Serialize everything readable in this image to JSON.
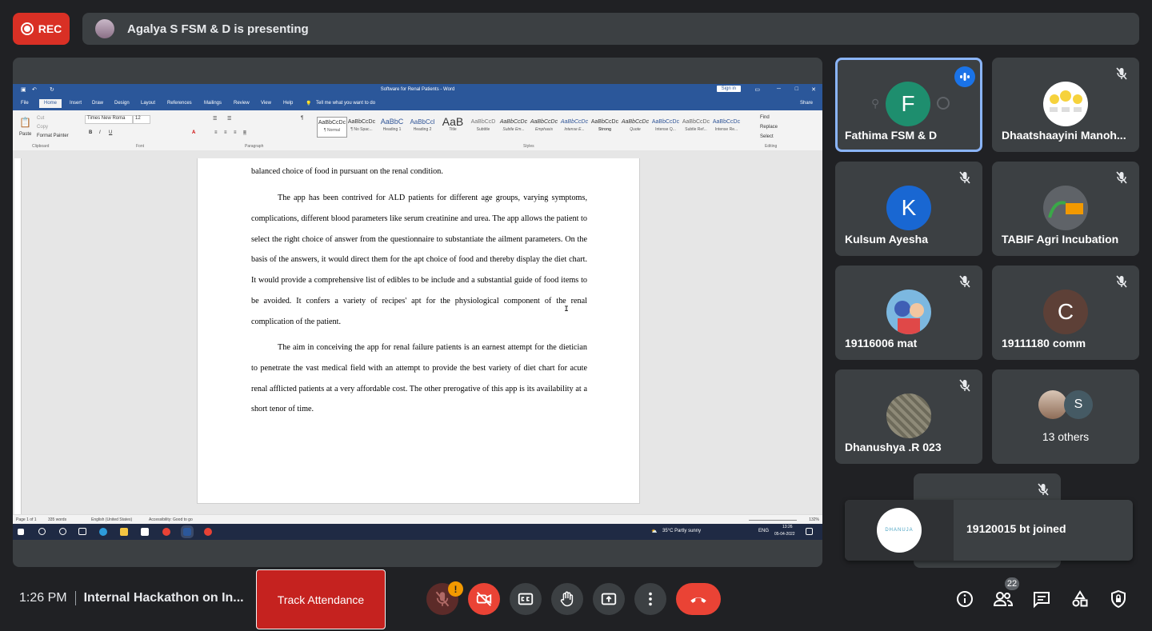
{
  "recording": {
    "label": "REC"
  },
  "presenting": {
    "text": "Agalya S FSM & D is presenting"
  },
  "word": {
    "title": "Software for Renal Patients - Word",
    "sign_in": "Sign in",
    "tabs": [
      "File",
      "Home",
      "Insert",
      "Draw",
      "Design",
      "Layout",
      "References",
      "Mailings",
      "Review",
      "View",
      "Help"
    ],
    "tell_me": "Tell me what you want to do",
    "share": "Share",
    "font_name": "Times New Roma",
    "font_size": "12",
    "clipboard": {
      "cut": "Cut",
      "copy": "Copy",
      "format_painter": "Format Painter",
      "paste": "Paste"
    },
    "groups": {
      "clipboard": "Clipboard",
      "font": "Font",
      "paragraph": "Paragraph",
      "styles": "Styles",
      "editing": "Editing"
    },
    "styles": [
      {
        "sample": "AaBbCcDc",
        "name": "¶ Normal"
      },
      {
        "sample": "AaBbCcDc",
        "name": "¶ No Spac..."
      },
      {
        "sample": "AaBbC",
        "name": "Heading 1"
      },
      {
        "sample": "AaBbCcl",
        "name": "Heading 2"
      },
      {
        "sample": "AaB",
        "name": "Title"
      },
      {
        "sample": "AaBbCcD",
        "name": "Subtitle"
      },
      {
        "sample": "AaBbCcDc",
        "name": "Subtle Em..."
      },
      {
        "sample": "AaBbCcDc",
        "name": "Emphasis"
      },
      {
        "sample": "AaBbCcDc",
        "name": "Intense E..."
      },
      {
        "sample": "AaBbCcDc",
        "name": "Strong"
      },
      {
        "sample": "AaBbCcDc",
        "name": "Quote"
      },
      {
        "sample": "AaBbCcDc",
        "name": "Intense Q..."
      },
      {
        "sample": "AaBbCcDc",
        "name": "Subtle Ref..."
      },
      {
        "sample": "AaBbCcDc",
        "name": "Intense Re..."
      }
    ],
    "editing": {
      "find": "Find",
      "replace": "Replace",
      "select": "Select"
    },
    "paragraphs": [
      "balanced choice of food in pursuant on the renal condition.",
      "The app has been contrived for ALD patients for different age groups, varying symptoms, complications, different blood parameters like serum creatinine and urea. The app allows the patient to select the right choice of answer from the questionnaire to substantiate the ailment parameters. On the basis of the answers, it would direct them for the apt choice of food and thereby display the diet chart. It would provide a comprehensive list of edibles to be include and a substantial guide of food items to be avoided. It confers a variety of recipes' apt for the physiological component of the renal complication of the patient.",
      "The aim in conceiving the app for renal failure patients is an earnest attempt for the dietician to penetrate the vast medical field with an attempt to provide the best variety of diet chart for acute renal afflicted patients at a very affordable cost. The other prerogative of this app is its availability at a short tenor of time."
    ],
    "status": {
      "page": "Page 1 of 1",
      "words": "335 words",
      "language": "English (United States)",
      "accessibility": "Accessibility: Good to go",
      "zoom": "132%"
    },
    "taskbar": {
      "weather": "35°C  Partly sunny",
      "lang": "ENG",
      "time": "13:26",
      "date": "05-04-2022"
    }
  },
  "participants": [
    {
      "name": "Fathima FSM & D",
      "initial": "F",
      "color": "#1e8e6e",
      "speaking": true
    },
    {
      "name": "Dhaatshaayini Manoh...",
      "initial": "",
      "color": "#ffffff"
    },
    {
      "name": "Kulsum Ayesha",
      "initial": "K",
      "color": "#1967d2"
    },
    {
      "name": "TABIF Agri Incubation",
      "initial": "",
      "color": "#5f6368"
    },
    {
      "name": "19116006 mat",
      "initial": "",
      "color": "#7cb8e0"
    },
    {
      "name": "19111180 comm",
      "initial": "C",
      "color": "#5d4037"
    },
    {
      "name": "Dhanushya .R 023",
      "initial": "",
      "color": "#6d6a5a"
    }
  ],
  "others": {
    "label": "13 others",
    "initial": "S"
  },
  "toast": {
    "message": "19120015 bt joined",
    "logo_text": "DHANUJA"
  },
  "bottom": {
    "time": "1:26 PM",
    "meeting": "Internal Hackathon on In...",
    "track": "Track Attendance",
    "people_count": "22",
    "warning": "!"
  }
}
